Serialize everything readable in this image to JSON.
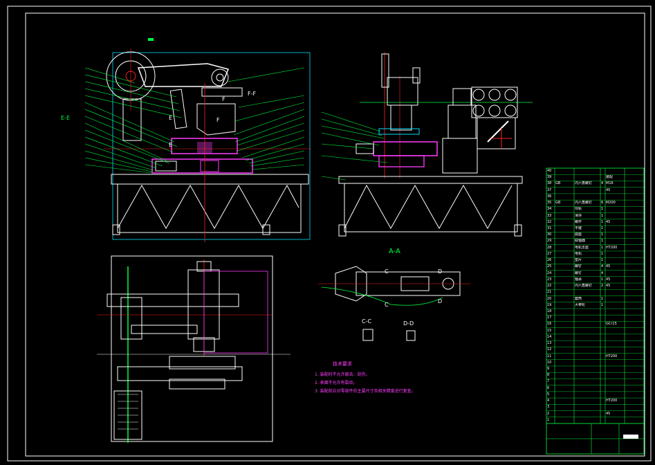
{
  "colors": {
    "background": "#000000",
    "frame": "#ffffff",
    "drawing_line": "#ffffff",
    "center_line": "#ff2020",
    "dimension": "#00ff40",
    "hidden_part": "#ff3cff",
    "leader": "#00ff40",
    "cyan_line": "#00e0ff",
    "yellow": "#ffff00",
    "blue": "#4040ff"
  },
  "view_labels": {
    "section_aa": "A-A",
    "section_ee": "E-E",
    "section_ff": "F-F",
    "section_cc": "C-C",
    "section_dd": "D-D",
    "marker_e": "E",
    "marker_f": "F",
    "marker_c": "C",
    "marker_d": "D"
  },
  "tech_notes": {
    "title": "技术要求",
    "items": [
      "1. 装配时不允许敲击、刮伤。",
      "2. 表面不允许有裂纹。",
      "3. 装配前应对零部件的主要尺寸及相关精度进行复查。"
    ]
  },
  "bom": {
    "rows": [
      [
        "40",
        "",
        "",
        "",
        ""
      ],
      [
        "39",
        "",
        "",
        "",
        "装配"
      ],
      [
        "38",
        "GB",
        "内六角螺钉",
        "4",
        "M16"
      ],
      [
        "37",
        "",
        "",
        "",
        "45"
      ],
      [
        "36",
        "",
        "",
        "",
        ""
      ],
      [
        "35",
        "GB",
        "内六角螺钉",
        "6",
        "M200"
      ],
      [
        "34",
        "",
        "导轨",
        "1",
        ""
      ],
      [
        "33",
        "",
        "滑块",
        "1",
        ""
      ],
      [
        "32",
        "",
        "螺杆",
        "1",
        "45"
      ],
      [
        "31",
        "",
        "平键",
        "1",
        ""
      ],
      [
        "30",
        "",
        "底座",
        "1",
        ""
      ],
      [
        "29",
        "",
        "联轴器",
        "1",
        ""
      ],
      [
        "28",
        "",
        "电机支座",
        "1",
        "HT200"
      ],
      [
        "27",
        "",
        "电机",
        "1",
        ""
      ],
      [
        "26",
        "",
        "垫片",
        "1",
        ""
      ],
      [
        "25",
        "",
        "螺钉",
        "4",
        "45"
      ],
      [
        "24",
        "",
        "螺钉",
        "4",
        ""
      ],
      [
        "23",
        "",
        "轴承",
        "1",
        "45"
      ],
      [
        "22",
        "",
        "内六角螺钉",
        "2",
        "45"
      ],
      [
        "21",
        "",
        "",
        "",
        ""
      ],
      [
        "20",
        "",
        "套筒",
        "1",
        ""
      ],
      [
        "19",
        "",
        "大带轮",
        "1",
        ""
      ],
      [
        "18",
        "",
        "",
        "",
        ""
      ],
      [
        "17",
        "",
        "",
        "",
        ""
      ],
      [
        "16",
        "",
        "",
        "",
        "GCr15"
      ],
      [
        "15",
        "",
        "",
        "",
        ""
      ],
      [
        "14",
        "",
        "",
        "",
        ""
      ],
      [
        "13",
        "",
        "",
        "",
        ""
      ],
      [
        "12",
        "",
        "",
        "",
        ""
      ],
      [
        "11",
        "",
        "",
        "",
        "HT200"
      ],
      [
        "10",
        "",
        "",
        "",
        ""
      ],
      [
        "9",
        "",
        "",
        "",
        ""
      ],
      [
        "8",
        "",
        "",
        "",
        ""
      ],
      [
        "7",
        "",
        "",
        "",
        ""
      ],
      [
        "6",
        "",
        "",
        "",
        ""
      ],
      [
        "5",
        "",
        "",
        "",
        ""
      ],
      [
        "4",
        "",
        "",
        "",
        "HT200"
      ],
      [
        "3",
        "",
        "",
        "",
        ""
      ],
      [
        "2",
        "",
        "",
        "",
        "45"
      ],
      [
        "1",
        "",
        "",
        "",
        ""
      ]
    ]
  }
}
